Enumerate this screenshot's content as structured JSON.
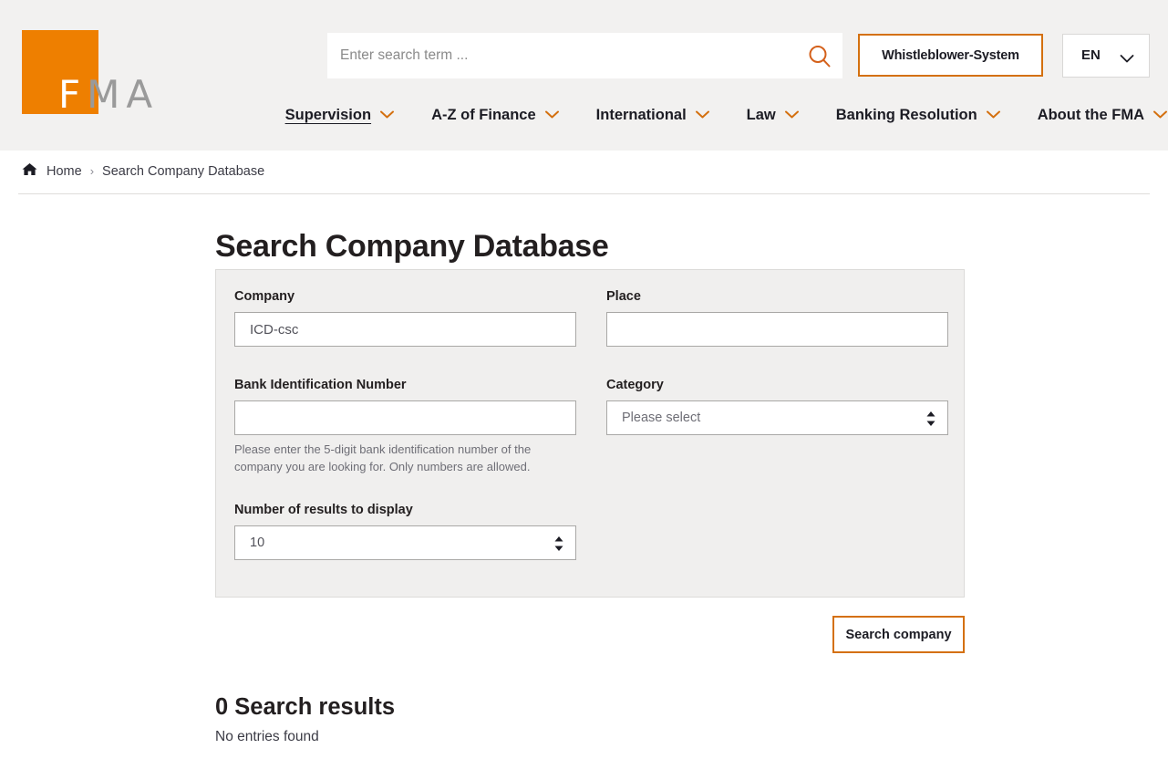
{
  "colors": {
    "brand_orange": "#ee7f00",
    "border_orange": "#d4700f",
    "header_bg": "#f2f1f0",
    "panel_bg": "#f0efee",
    "text_dark": "#231f20",
    "text_muted": "#6e6e76"
  },
  "header": {
    "logo": {
      "mark_letter": "F",
      "wordmark": "MA",
      "alt": "FMA"
    },
    "search": {
      "value": "",
      "placeholder": "Enter search term ...",
      "icon": "search-icon"
    },
    "whistleblower_label": "Whistleblower-System",
    "language": {
      "selected": "EN",
      "icon": "chevron-down-icon"
    },
    "nav": [
      {
        "label": "Supervision",
        "active": true,
        "icon": "chevron-down-icon"
      },
      {
        "label": "A-Z of Finance",
        "active": false,
        "icon": "chevron-down-icon"
      },
      {
        "label": "International",
        "active": false,
        "icon": "chevron-down-icon"
      },
      {
        "label": "Law",
        "active": false,
        "icon": "chevron-down-icon"
      },
      {
        "label": "Banking Resolution",
        "active": false,
        "icon": "chevron-down-icon"
      },
      {
        "label": "About the FMA",
        "active": false,
        "icon": "chevron-down-icon"
      }
    ]
  },
  "breadcrumb": {
    "home_icon": "home-icon",
    "home_label": "Home",
    "separator": "›",
    "current": "Search Company Database"
  },
  "main": {
    "title": "Search Company Database",
    "form": {
      "company": {
        "label": "Company",
        "value": "ICD-csc",
        "placeholder": ""
      },
      "place": {
        "label": "Place",
        "value": "",
        "placeholder": ""
      },
      "bank_id": {
        "label": "Bank Identification Number",
        "value": "",
        "placeholder": "",
        "help": "Please enter the 5-digit bank identification number of the company you are looking for. Only numbers are allowed."
      },
      "category": {
        "label": "Category",
        "selected": "Please select",
        "icon": "sort-arrows-icon"
      },
      "results_count": {
        "label": "Number of results to display",
        "selected": "10",
        "icon": "sort-arrows-icon"
      }
    },
    "submit_label": "Search company",
    "results": {
      "heading": "0 Search results",
      "empty_text": "No entries found"
    }
  }
}
